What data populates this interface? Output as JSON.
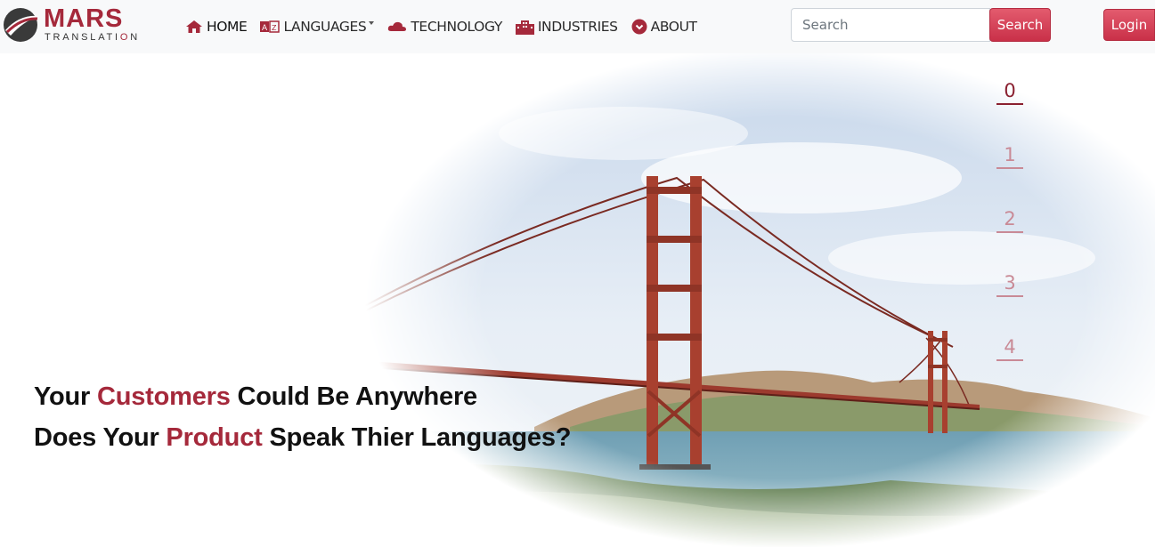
{
  "logo": {
    "brand": "MARS",
    "sub_pre": "TRANSLATI",
    "sub_o": "O",
    "sub_post": "N"
  },
  "nav": {
    "home": "HOME",
    "languages": "LANGUAGES",
    "technology": "TECHNOLOGY",
    "industries": "INDUSTRIES",
    "about": "ABOUT"
  },
  "search": {
    "placeholder": "Search",
    "button": "Search"
  },
  "login": "Login",
  "hero": {
    "line1_a": "Your ",
    "line1_hl": "Customers",
    "line1_b": " Could Be Anywhere",
    "line2_a": "Does Your ",
    "line2_hl": "Product",
    "line2_b": " Speak Thier Languages?"
  },
  "carousel": {
    "indicators": [
      "0",
      "1",
      "2",
      "3",
      "4"
    ],
    "active": 0
  },
  "colors": {
    "brand": "#a5293b",
    "button": "#d7415a"
  },
  "icons": [
    "mars-logo-icon",
    "home-icon",
    "language-icon",
    "cloud-icon",
    "building-icon",
    "info-circle-icon"
  ]
}
